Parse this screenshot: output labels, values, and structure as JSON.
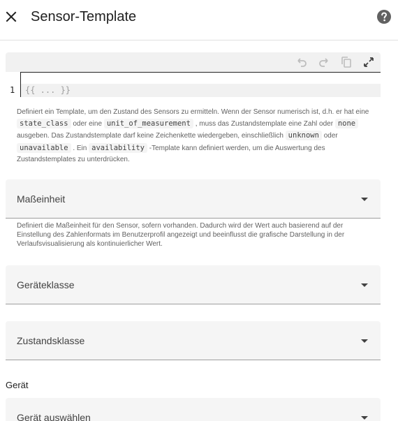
{
  "header": {
    "title": "Sensor-Template",
    "close_icon": "close-icon",
    "help_icon": "help-circle-icon"
  },
  "editor": {
    "toolbar_icons": [
      "undo-icon",
      "redo-icon",
      "copy-icon",
      "fullscreen-icon"
    ],
    "line_number": "1",
    "placeholder": "{{ ... }}"
  },
  "template_helper": {
    "t1": "Definiert ein Template, um den Zustand des Sensors zu ermitteln. Wenn der Sensor numerisch ist, d.h. er hat eine",
    "c1": "state_class",
    "t2": "oder eine",
    "c2": "unit_of_measurement",
    "t3": ", muss das Zustandstemplate eine Zahl oder",
    "c3": "none",
    "t4": "ausgeben. Das Zustandstemplate darf keine Zeichenkette wiedergeben, einschließlich",
    "c4": "unknown",
    "t5": "oder",
    "c5": "unavailable",
    "t6": ". Ein",
    "c6": "availability",
    "t7": "-Template kann definiert werden, um die Auswertung des Zustandstemplates zu unterdrücken."
  },
  "unit_field": {
    "label": "Maßeinheit",
    "helper": "Definiert die Maßeinheit für den Sensor, sofern vorhanden. Dadurch wird der Wert auch basierend auf der Einstellung des Zahlenformats im Benutzerprofil angezeigt und beeinflusst die grafische Darstellung in der Verlaufsvisualisierung als kontinuierlicher Wert."
  },
  "device_class_field": {
    "label": "Geräteklasse"
  },
  "state_class_field": {
    "label": "Zustandsklasse"
  },
  "device_section": {
    "title": "Gerät",
    "select_label": "Gerät auswählen"
  },
  "colors": {
    "field_bg": "#f5f5f5",
    "toolbar_bg": "#f1f1f1",
    "text_primary": "#212121",
    "text_secondary": "#616161"
  }
}
